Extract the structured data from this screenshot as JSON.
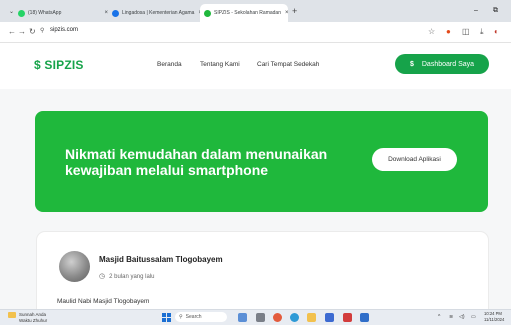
{
  "browser": {
    "tabs": [
      {
        "label": "(18) WhatsApp",
        "favicon_color": "#25d366",
        "active": false
      },
      {
        "label": "Lingadosa | Kementerian Agama",
        "favicon_color": "#1a73e8",
        "active": false
      },
      {
        "label": "SIPZIS - Sekolahan Ramadan",
        "favicon_color": "#1fb83c",
        "active": true
      }
    ],
    "close_glyph": "×",
    "new_tab_glyph": "+",
    "url": "sipzis.com",
    "minimize_glyph": "–",
    "maximize_glyph": "⧉"
  },
  "header": {
    "logo": "SIPZIS",
    "menu": [
      "Beranda",
      "Tentang Kami",
      "Cari Tempat Sedekah"
    ],
    "dashboard_button": "Dashboard Saya"
  },
  "banner": {
    "headline": "Nikmati kemudahan dalam menunaikan kewajiban melalui smartphone",
    "download_button": "Download Aplikasi",
    "color": "#1fb83c"
  },
  "feed": {
    "mosque_name": "Masjid Baitussalam Tlogobayem",
    "time_ago": "2 bulan yang lalu",
    "post_text": "Maulid Nabi Masjid Tlogobayem"
  },
  "taskbar": {
    "widget_line1": "Sunnah Anda",
    "widget_line2": "Waktu Zhuhur",
    "search_placeholder": "Search",
    "time": "10:24 PM",
    "date": "11/11/2024"
  },
  "colors": {
    "brand_green": "#16a34a"
  }
}
